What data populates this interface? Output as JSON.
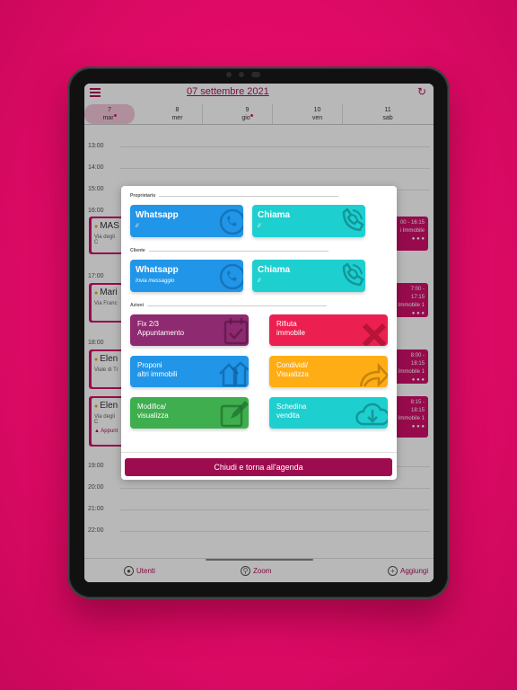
{
  "header": {
    "date_title": "07 settembre 2021"
  },
  "days": [
    {
      "num": "7",
      "name": "mar",
      "selected": true,
      "dot": true
    },
    {
      "num": "8",
      "name": "mer",
      "selected": false,
      "dot": false
    },
    {
      "num": "9",
      "name": "gio",
      "selected": false,
      "dot": true
    },
    {
      "num": "10",
      "name": "ven",
      "selected": false,
      "dot": false
    },
    {
      "num": "11",
      "name": "sab",
      "selected": false,
      "dot": false
    }
  ],
  "hours": [
    "13:00",
    "14:00",
    "15:00",
    "16:00",
    "17:00",
    "18:00",
    "19:00",
    "20:00",
    "21:00",
    "22:00"
  ],
  "events": [
    {
      "name": "MAS",
      "address": "Via degli C",
      "time": "00 - 16:15",
      "detail": "i Immobile"
    },
    {
      "name": "Mari",
      "address": "Via Franc",
      "time": "7:00 - 17:15",
      "detail": "Immobile 1"
    },
    {
      "name": "Elen",
      "address": "Viale di Tr",
      "time": "8:00 - 18:15",
      "detail": "Immobile 1"
    },
    {
      "name": "Elen",
      "address": "Via degli C",
      "note": "Appunt",
      "time": "8:15 - 18:15",
      "detail": "Immobile 1"
    }
  ],
  "modal": {
    "section_owner": "Proprietario",
    "section_client": "Cliente",
    "section_actions": "Azioni",
    "owner_whatsapp": {
      "title": "Whatsapp",
      "sub": "//"
    },
    "owner_call": {
      "title": "Chiama",
      "sub": "//"
    },
    "client_whatsapp": {
      "title": "Whatsapp",
      "sub": "Invia messaggio"
    },
    "client_call": {
      "title": "Chiama",
      "sub": "//"
    },
    "actions": {
      "fix": "Fix 2/3\nAppuntamento",
      "reject": "Rifiuta\nimmobile",
      "propose": "Proponi\naltri immobili",
      "share": "Condividi/\nVisualizza",
      "edit": "Modifica/\nvisualizza",
      "sheet": "Schedina\nvendita"
    },
    "close_label": "Chiudi e torna all'agenda"
  },
  "bottom_bar": {
    "users": "Utenti",
    "zoom": "Zoom",
    "add": "Aggiungi"
  },
  "colors": {
    "brand": "#b0125d",
    "whatsapp_blue": "#2196e8",
    "call_cyan": "#1ecfd0",
    "fix_purple": "#8e2a6f",
    "reject_red": "#ec2050",
    "propose_blue": "#2196e8",
    "share_orange": "#ffad14",
    "edit_green": "#3fae4f",
    "sheet_cyan": "#1ecfd0"
  }
}
